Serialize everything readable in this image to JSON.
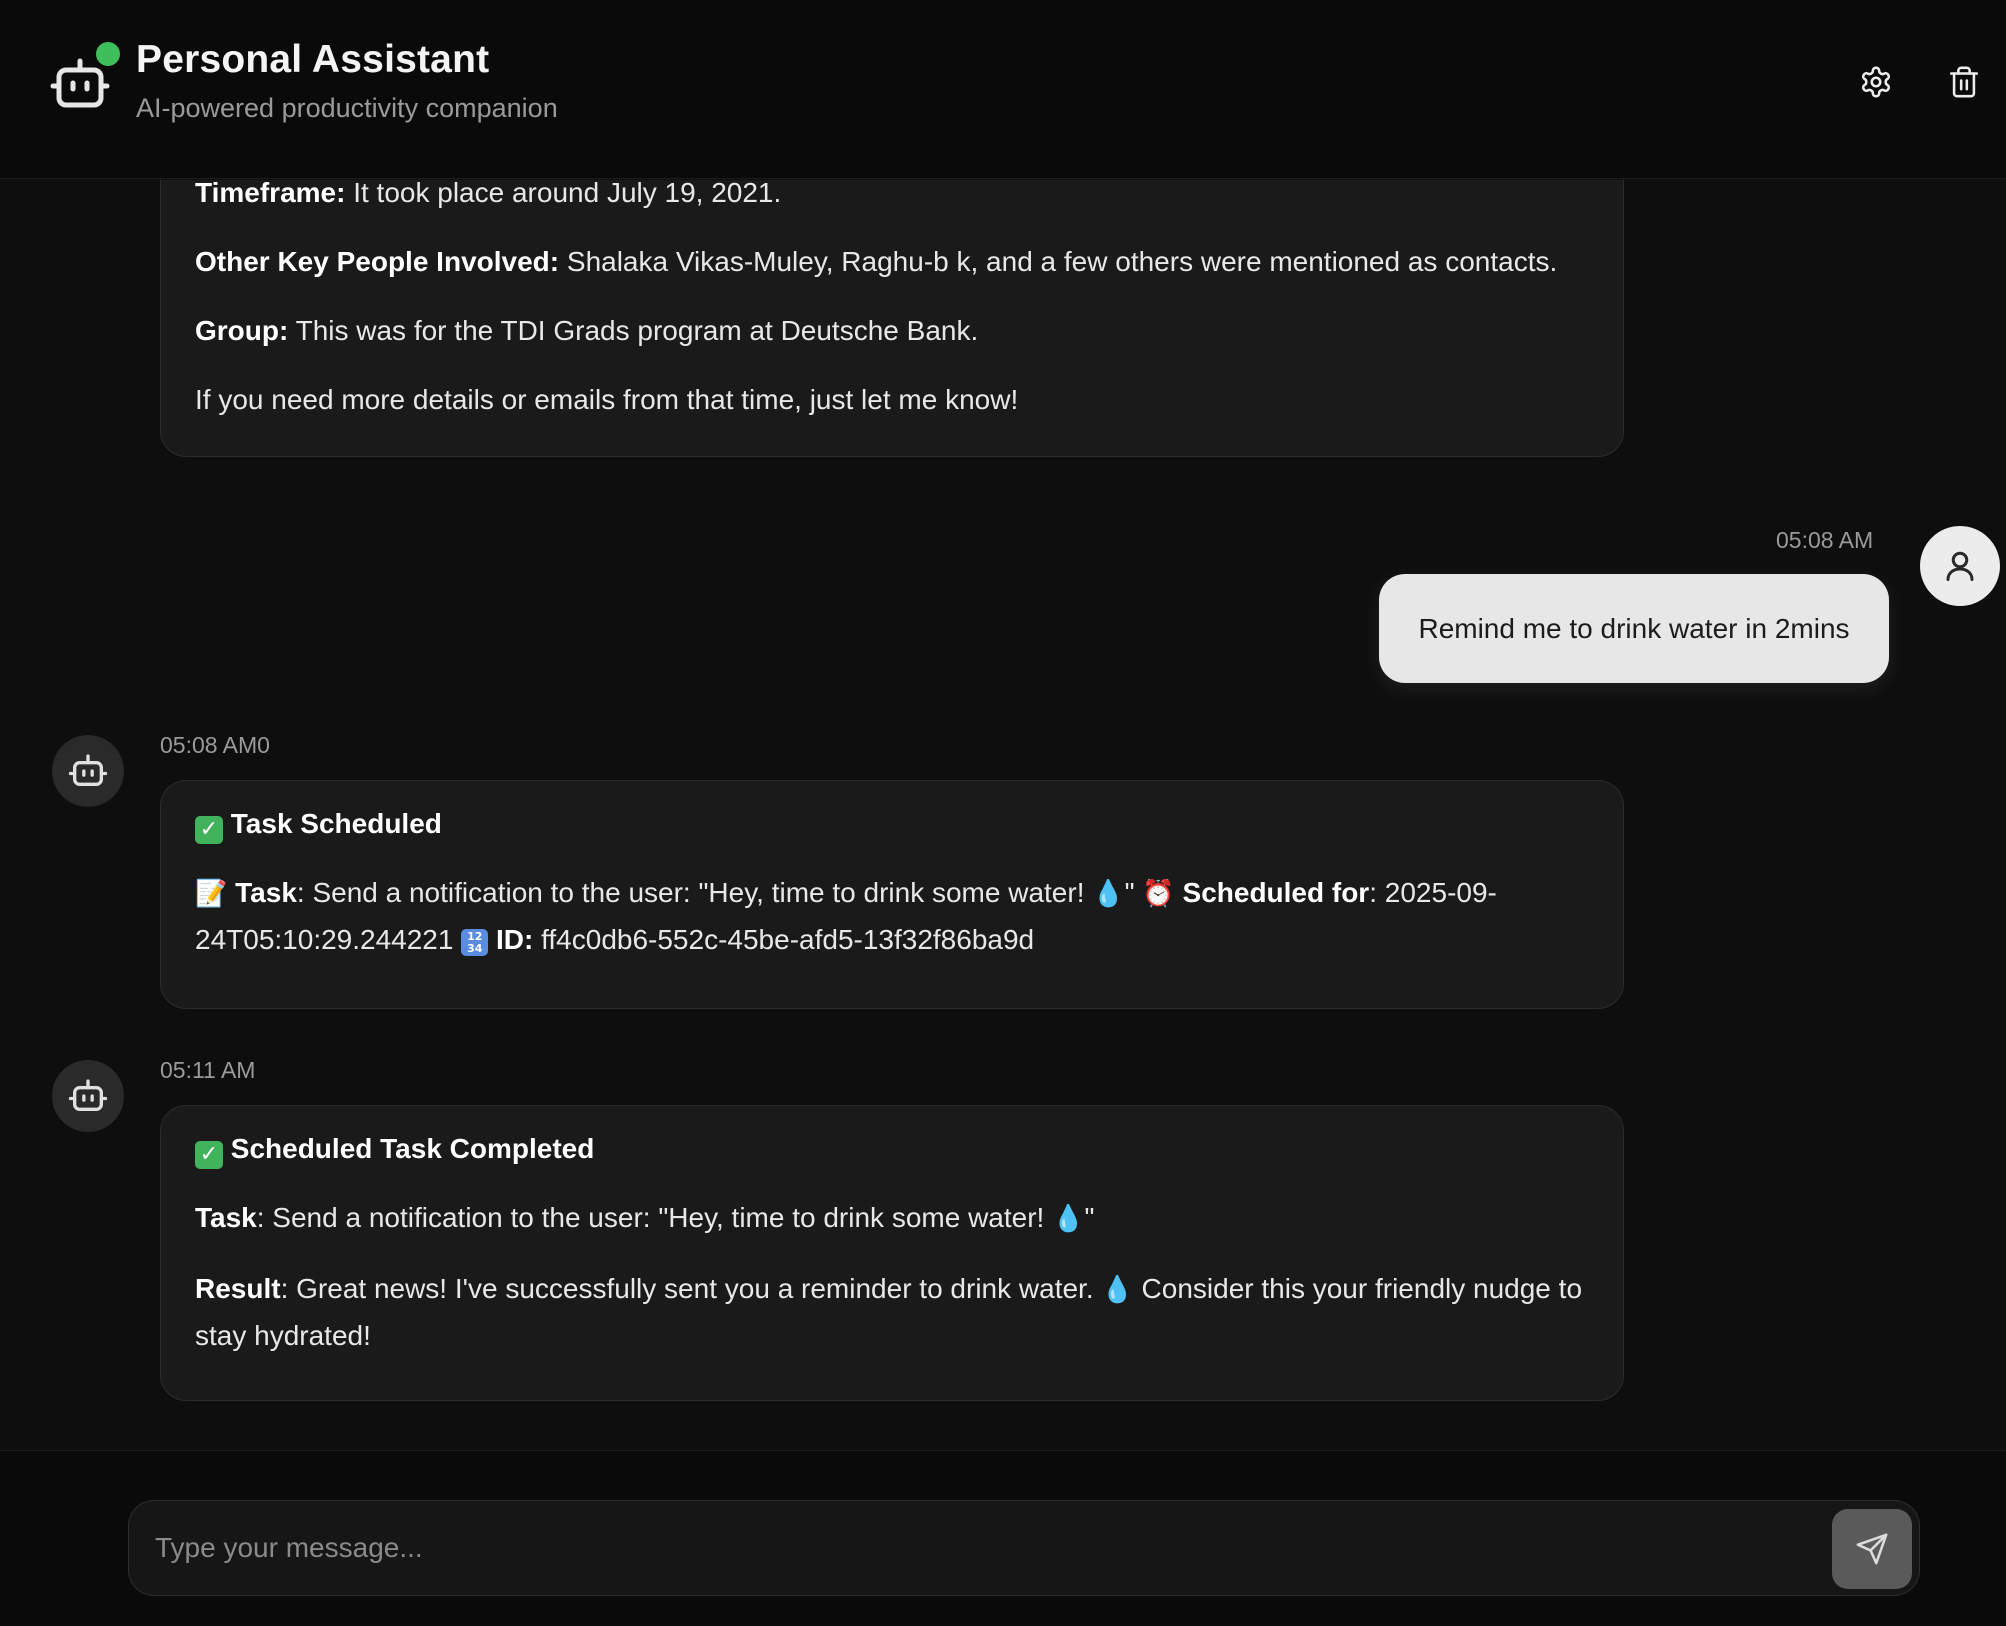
{
  "header": {
    "title": "Personal Assistant",
    "subtitle": "AI-powered productivity companion",
    "status": "online",
    "status_color": "#3fbf5b",
    "icons": [
      "robot-icon",
      "gear-icon",
      "trash-icon"
    ]
  },
  "messages": {
    "prev_bot": {
      "timeframe_label": "Timeframe:",
      "timeframe_text": " It took place around July 19, 2021.",
      "people_label": "Other Key People Involved:",
      "people_text": " Shalaka Vikas-Muley, Raghu-b k, and a few others were mentioned as contacts.",
      "group_label": "Group:",
      "group_text": " This was for the TDI Grads program at Deutsche Bank.",
      "closing": "If you need more details or emails from that time, just let me know!"
    },
    "user_msg": {
      "time": "05:08 AM",
      "text": "Remind me to drink water in 2mins"
    },
    "task_scheduled": {
      "time": "05:08 AM0",
      "heading": "Task Scheduled",
      "task_label": "Task",
      "task_text": ": Send a notification to the user: \"Hey, time to drink some water! ",
      "task_text_end": "\" ",
      "scheduled_label": "Scheduled for",
      "scheduled_text": ": 2025-09-24T05:10:29.244221 ",
      "id_label": "ID:",
      "id_text": " ff4c0db6-552c-45be-afd5-13f32f86ba9d"
    },
    "task_completed": {
      "time": "05:11 AM",
      "heading": "Scheduled Task Completed",
      "task_label": "Task",
      "task_text": ": Send a notification to the user: \"Hey, time to drink some water! ",
      "task_text_end": "\"",
      "result_label": "Result",
      "result_text": ": Great news! I've successfully sent you a reminder to drink water. ",
      "result_text_end": " Consider this your friendly nudge to stay hydrated!"
    }
  },
  "composer": {
    "placeholder": "Type your message...",
    "send_icon": "send-icon"
  },
  "colors": {
    "background": "#0e0e0e",
    "bot_bubble": "#1a1a1a",
    "user_bubble": "#e7e7e7",
    "send_button": "#5a5a5a"
  }
}
